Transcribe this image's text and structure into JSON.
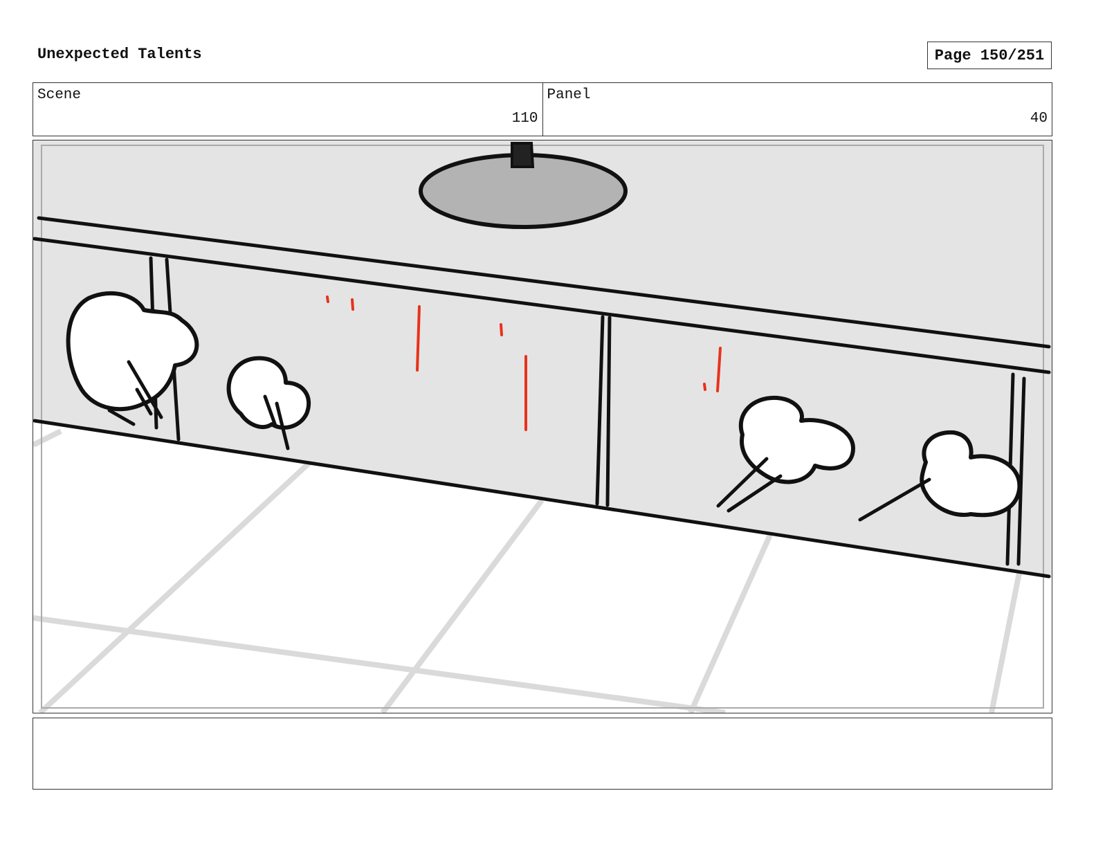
{
  "header": {
    "title": "Unexpected Talents",
    "page_label": "Page 150/251"
  },
  "info": {
    "scene_label": "Scene",
    "scene_value": "110",
    "panel_label": "Panel",
    "panel_value": "40"
  },
  "frame": {
    "illustration": "storyboard-sketch-sink-cabinet-smoke-puffs",
    "colors": {
      "wall": "#e4e4e4",
      "floor": "#ffffff",
      "sink": "#b3b3b3",
      "drips": "#e8321c",
      "tile_lines": "#dadada"
    }
  },
  "notes": {
    "text": ""
  }
}
